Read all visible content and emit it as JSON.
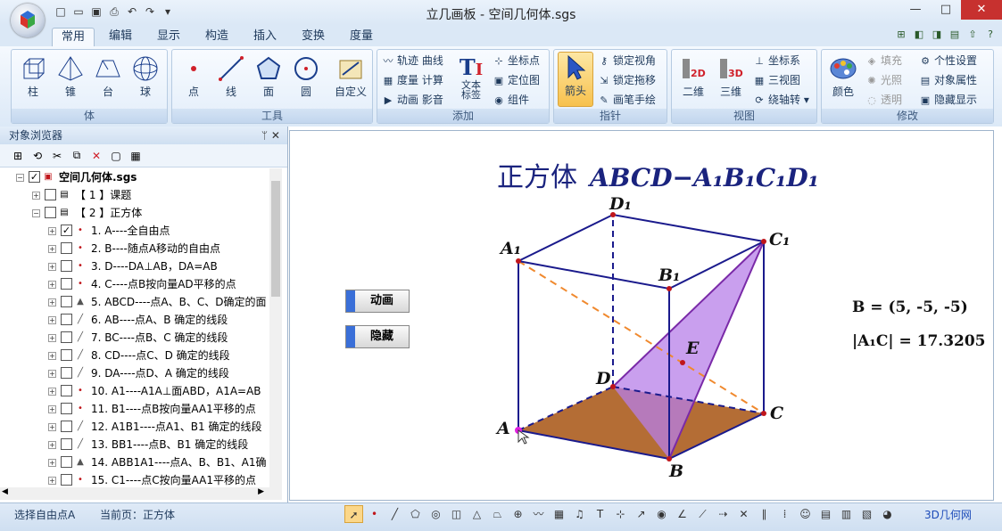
{
  "window": {
    "title": "立几画板 - 空间几何体.sgs"
  },
  "tabs": [
    "常用",
    "编辑",
    "显示",
    "构造",
    "插入",
    "变换",
    "度量"
  ],
  "ribbon": {
    "groups": {
      "solid": "体",
      "tools": "工具",
      "add": "添加",
      "pointer": "指针",
      "view": "视图",
      "modify": "修改"
    },
    "solid": [
      "柱",
      "锥",
      "台",
      "球"
    ],
    "tools": [
      "点",
      "线",
      "面",
      "圆",
      "自定义"
    ],
    "add_small": [
      "轨迹 曲线",
      "度量 计算",
      "动画 影音",
      "坐标点",
      "定位图",
      "组件"
    ],
    "add_text": "文本\n标签",
    "pointer": {
      "arrow": "箭头",
      "lock_view": "锁定视角",
      "lock_drag": "锁定拖移",
      "pen": "画笔手绘"
    },
    "view": {
      "v2d": "二维",
      "v3d": "三维",
      "axis": "坐标系",
      "three_view": "三视图",
      "rotate": "绕轴转"
    },
    "modify": {
      "color": "颜色",
      "fill": "填充",
      "light": "光照",
      "transparent": "透明",
      "personal": "个性设置",
      "props": "对象属性",
      "hide": "隐藏显示"
    }
  },
  "panel": {
    "title": "对象浏览器"
  },
  "tree": [
    {
      "label": "空间几何体.sgs",
      "level": 0,
      "checked": true,
      "bold": true
    },
    {
      "label": "【 1 】课题",
      "level": 1,
      "checked": false
    },
    {
      "label": "【 2 】正方体",
      "level": 1,
      "checked": false
    },
    {
      "label": "1. A----全自由点",
      "level": 2,
      "checked": true
    },
    {
      "label": "2. B----随点A移动的自由点",
      "level": 2,
      "checked": false
    },
    {
      "label": "3. D----DA⊥AB，DA=AB",
      "level": 2,
      "checked": false
    },
    {
      "label": "4. C----点B按向量AD平移的点",
      "level": 2,
      "checked": false
    },
    {
      "label": "5. ABCD----点A、B、C、D确定的面",
      "level": 2,
      "checked": false
    },
    {
      "label": "6. AB----点A、B 确定的线段",
      "level": 2,
      "checked": false
    },
    {
      "label": "7. BC----点B、C 确定的线段",
      "level": 2,
      "checked": false
    },
    {
      "label": "8. CD----点C、D 确定的线段",
      "level": 2,
      "checked": false
    },
    {
      "label": "9. DA----点D、A 确定的线段",
      "level": 2,
      "checked": false
    },
    {
      "label": "10. A1----A1A⊥面ABD，A1A=AB",
      "level": 2,
      "checked": false
    },
    {
      "label": "11. B1----点B按向量AA1平移的点",
      "level": 2,
      "checked": false
    },
    {
      "label": "12. A1B1----点A1、B1 确定的线段",
      "level": 2,
      "checked": false
    },
    {
      "label": "13. BB1----点B、B1 确定的线段",
      "level": 2,
      "checked": false
    },
    {
      "label": "14. ABB1A1----点A、B、B1、A1确",
      "level": 2,
      "checked": false
    },
    {
      "label": "15. C1----点C按向量AA1平移的点",
      "level": 2,
      "checked": false
    }
  ],
  "canvas": {
    "title_cn": "正方体",
    "title_math": "ABCD−A₁B₁C₁D₁",
    "buttons": {
      "animate": "动画",
      "hide": "隐藏"
    },
    "coord_label": "B = (5, -5, -5)",
    "length_label": "|A₁C| = 17.3205",
    "points": {
      "A": "A",
      "B": "B",
      "C": "C",
      "D": "D",
      "E": "E",
      "A1": "A₁",
      "B1": "B₁",
      "C1": "C₁",
      "D1": "D₁"
    },
    "colors": {
      "edge": "#1a1a8c",
      "base": "#b0652a",
      "triangle": "#b77fe8",
      "diagonal": "#f0892e",
      "point": "#c0161b"
    }
  },
  "status": {
    "left": "选择自由点A",
    "page": "当前页：正方体",
    "link": "3D几何网"
  }
}
